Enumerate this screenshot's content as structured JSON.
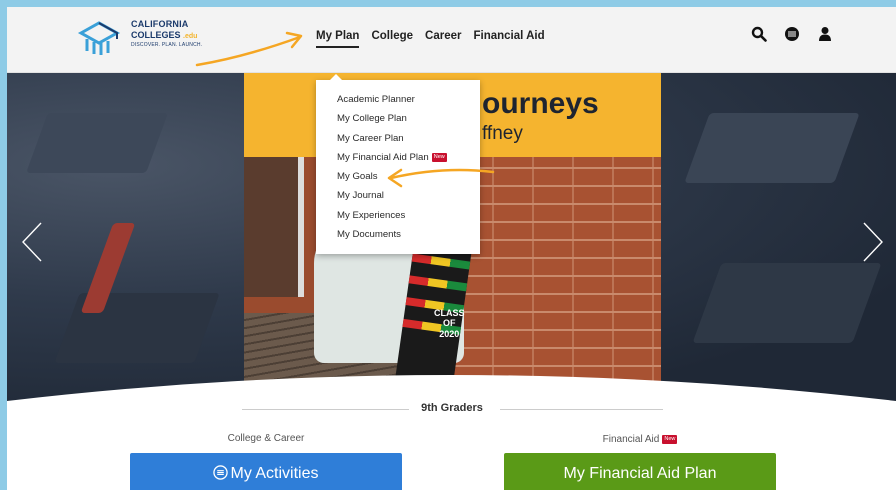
{
  "logo": {
    "line1": "CALIFORNIA",
    "line2": "COLLEGES",
    "edu": ".edu",
    "tagline": "DISCOVER. PLAN. LAUNCH."
  },
  "nav": {
    "items": [
      "My Plan",
      "College",
      "Career",
      "Financial Aid"
    ],
    "active": "My Plan"
  },
  "header_icons": [
    "search-icon",
    "language-icon",
    "user-icon"
  ],
  "hero": {
    "title_fragment": "ourneys",
    "subtitle_fragment": "ffney",
    "photo_text": [
      "CLASS",
      "OF",
      "2020"
    ]
  },
  "dropdown": {
    "items": [
      {
        "label": "Academic Planner"
      },
      {
        "label": "My College Plan"
      },
      {
        "label": "My Career Plan"
      },
      {
        "label": "My Financial Aid Plan",
        "badge": "New"
      },
      {
        "label": "My Goals"
      },
      {
        "label": "My Journal"
      },
      {
        "label": "My Experiences"
      },
      {
        "label": "My Documents"
      }
    ]
  },
  "section": {
    "title": "9th Graders",
    "left_label": "College & Career",
    "right_label": "Financial Aid",
    "right_badge": "New",
    "left_button": "My Activities",
    "right_button": "My Financial Aid Plan"
  },
  "colors": {
    "banner_yellow": "#f5b42f",
    "button_blue": "#2f7ed8",
    "button_green": "#5a9a17",
    "badge_red": "#c8102e",
    "arrow_orange": "#f5a623",
    "border_blue": "#8ecbe6"
  }
}
